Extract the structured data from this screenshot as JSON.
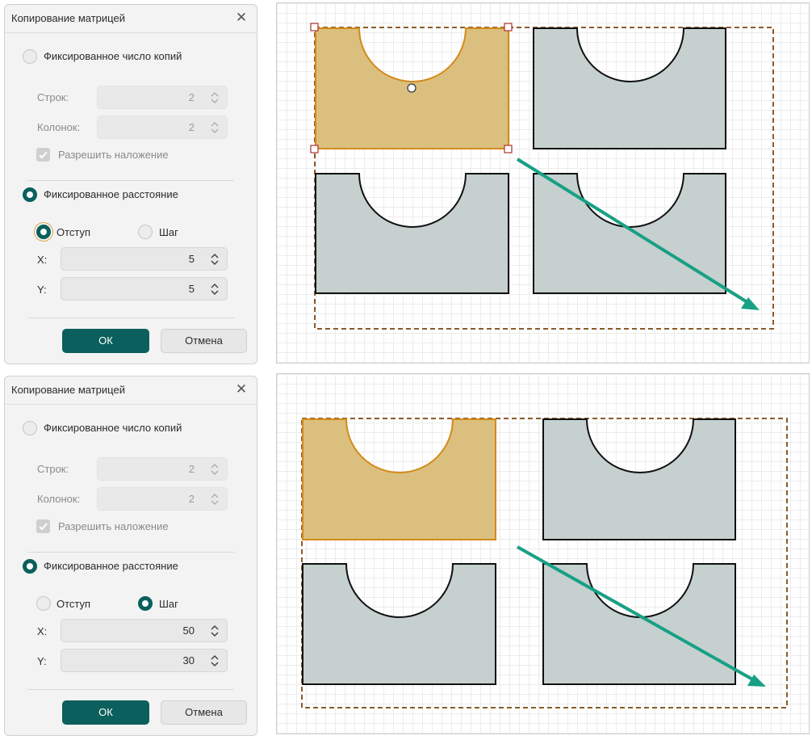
{
  "dialogs": [
    {
      "title": "Копирование матрицей",
      "mode_fixed_copies_label": "Фиксированное число копий",
      "rows_label": "Строк:",
      "rows_value": "2",
      "cols_label": "Колонок:",
      "cols_value": "2",
      "allow_overlap_label": "Разрешить наложение",
      "mode_fixed_distance_label": "Фиксированное расстояние",
      "offset_label": "Отступ",
      "step_label": "Шаг",
      "selected_sub_mode": "Отступ",
      "x_label": "X:",
      "x_value": "5",
      "y_label": "Y:",
      "y_value": "5",
      "ok_label": "ОК",
      "cancel_label": "Отмена"
    },
    {
      "title": "Копирование матрицей",
      "mode_fixed_copies_label": "Фиксированное число копий",
      "rows_label": "Строк:",
      "rows_value": "2",
      "cols_label": "Колонок:",
      "cols_value": "2",
      "allow_overlap_label": "Разрешить наложение",
      "mode_fixed_distance_label": "Фиксированное расстояние",
      "offset_label": "Отступ",
      "step_label": "Шаг",
      "selected_sub_mode": "Шаг",
      "x_label": "X:",
      "x_value": "50",
      "y_label": "Y:",
      "y_value": "30",
      "ok_label": "ОК",
      "cancel_label": "Отмена"
    }
  ],
  "colors": {
    "accent": "#0b5f5c",
    "selected_shape_fill": "#dbbf7e",
    "selected_shape_stroke": "#d48a1a",
    "copy_shape_fill": "#c5d0cf",
    "dashed_bounds": "#8b5a2b",
    "arrow": "#17a084",
    "handle": "#a33"
  },
  "icons": {
    "close": "close-icon",
    "spinner": "spinner-updown-icon",
    "checkbox": "checkmark-icon",
    "arrow": "diagonal-arrow-icon"
  }
}
